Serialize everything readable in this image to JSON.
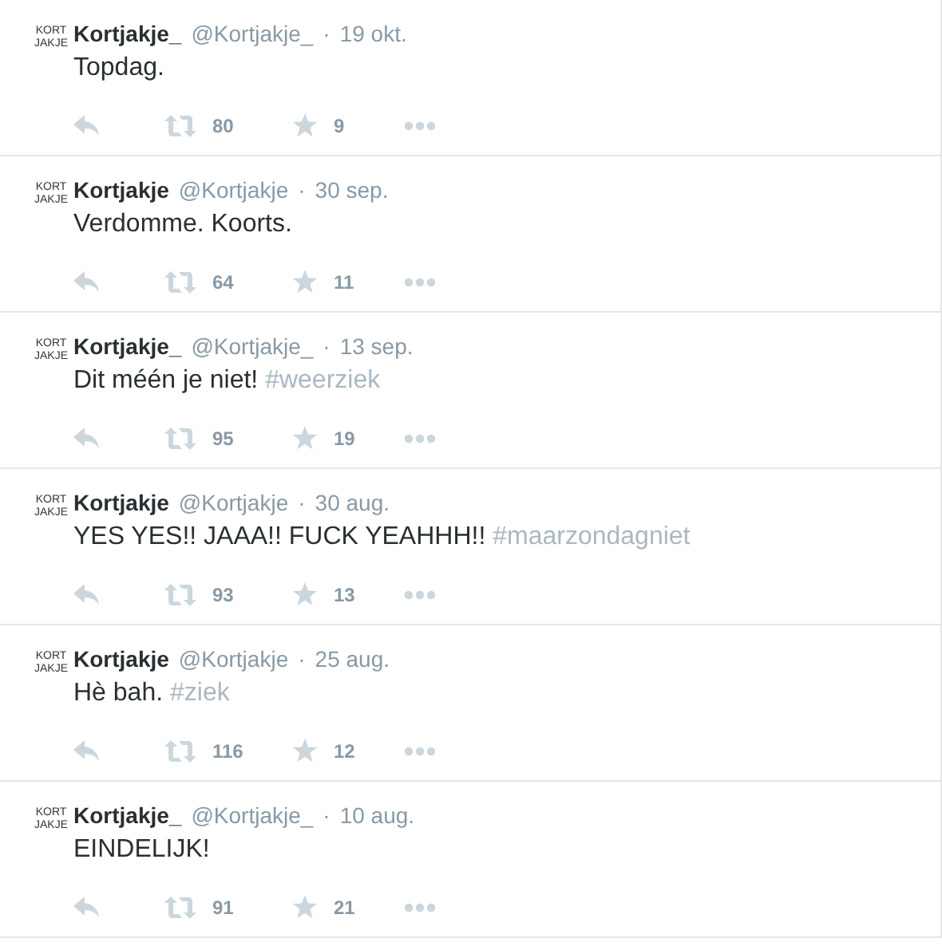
{
  "tweets": [
    {
      "avatar": [
        "KORT",
        "JAKJE"
      ],
      "name": "Kortjakje_",
      "handle": "@Kortjakje_",
      "separator": "·",
      "date": "19 okt.",
      "text": "Topdag.",
      "retweets": "80",
      "favorites": "9"
    },
    {
      "avatar": [
        "KORT",
        "JAKJE"
      ],
      "name": "Kortjakje",
      "handle": "@Kortjakje",
      "separator": "·",
      "date": "30 sep.",
      "text": "Verdomme. Koorts.",
      "retweets": "64",
      "favorites": "11"
    },
    {
      "avatar": [
        "KORT",
        "JAKJE"
      ],
      "name": "Kortjakje_",
      "handle": "@Kortjakje_",
      "separator": "·",
      "date": "13 sep.",
      "text": "Dit méén je niet!",
      "hashtag": "#weerziek",
      "retweets": "95",
      "favorites": "19"
    },
    {
      "avatar": [
        "KORT",
        "JAKJE"
      ],
      "name": "Kortjakje",
      "handle": "@Kortjakje",
      "separator": "·",
      "date": "30 aug.",
      "text": "YES YES!! JAAA!! FUCK YEAHHH!!",
      "hashtag": "#maarzondagniet",
      "retweets": "93",
      "favorites": "13"
    },
    {
      "avatar": [
        "KORT",
        "JAKJE"
      ],
      "name": "Kortjakje",
      "handle": "@Kortjakje",
      "separator": "·",
      "date": "25 aug.",
      "text": "Hè bah.",
      "hashtag": "#ziek",
      "retweets": "116",
      "favorites": "12"
    },
    {
      "avatar": [
        "KORT",
        "JAKJE"
      ],
      "name": "Kortjakje_",
      "handle": "@Kortjakje_",
      "separator": "·",
      "date": "10 aug.",
      "text": "EINDELIJK!",
      "retweets": "91",
      "favorites": "21"
    }
  ]
}
